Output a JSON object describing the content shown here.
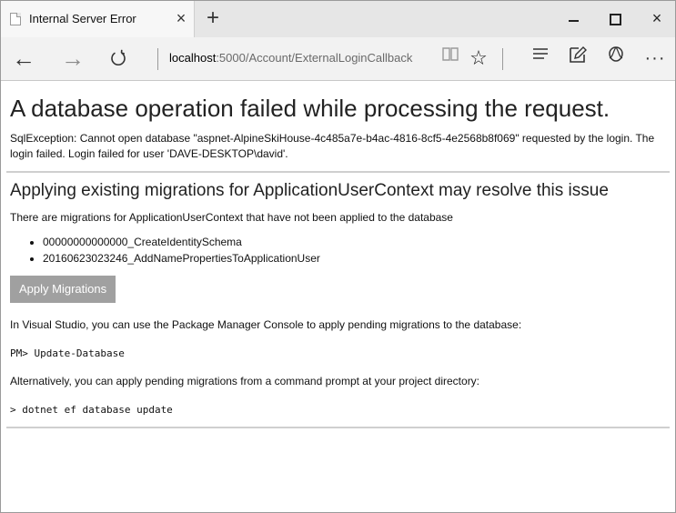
{
  "tab": {
    "title": "Internal Server Error",
    "close": "×",
    "new_tab": "+"
  },
  "window_controls": {
    "close": "×"
  },
  "nav": {
    "back": "←",
    "forward": "→",
    "address_host": "localhost",
    "address_path": ":5000/Account/ExternalLoginCallback",
    "favorite": "☆",
    "more": "···"
  },
  "page": {
    "heading": "A database operation failed while processing the request.",
    "exception": "SqlException: Cannot open database \"aspnet-AlpineSkiHouse-4c485a7e-b4ac-4816-8cf5-4e2568b8f069\" requested by the login. The login failed. Login failed for user 'DAVE-DESKTOP\\david'.",
    "subheading": "Applying existing migrations for ApplicationUserContext may resolve this issue",
    "migrations_intro": "There are migrations for ApplicationUserContext that have not been applied to the database",
    "migrations": [
      "00000000000000_CreateIdentitySchema",
      "20160623023246_AddNamePropertiesToApplicationUser"
    ],
    "apply_button": "Apply Migrations",
    "vs_text": "In Visual Studio, you can use the Package Manager Console to apply pending migrations to the database:",
    "pm_command": "PM> Update-Database",
    "alt_text": "Alternatively, you can apply pending migrations from a command prompt at your project directory:",
    "cli_command": "> dotnet ef database update"
  }
}
